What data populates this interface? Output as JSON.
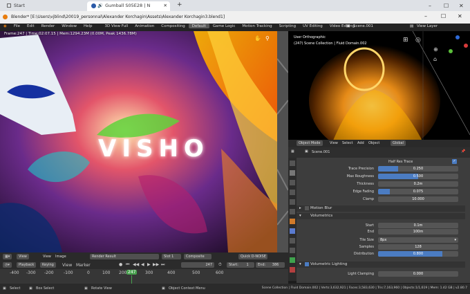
{
  "browser": {
    "tabs": [
      {
        "label": "Start"
      },
      {
        "label": "Gumball S05E28 | N"
      }
    ],
    "new_tab": "+",
    "window_controls": [
      "–",
      "☐",
      "✕"
    ]
  },
  "window": {
    "title": "Blender* [E:\\Users\\vjblind\\20019_personnal\\Alexander Korchagin\\Assets\\Alexander Korchagin3.blend1]"
  },
  "menubar": {
    "menus": [
      "File",
      "Edit",
      "Render",
      "Window",
      "Help"
    ],
    "workspaces": [
      "3D View Full",
      "Animation",
      "Compositing",
      "Default",
      "Game Logic",
      "Motion Tracking",
      "Scripting",
      "UV Editing",
      "Video Editing"
    ],
    "active_workspace": "Default",
    "scene": "Scene.001",
    "view_layer": "View Layer"
  },
  "viewport_left": {
    "status": "Frame:247 | Time:02:07.15 | Mem:1294.23M (0.00M, Peak 1436.78M)",
    "overlay_text": "VISHO",
    "footer": {
      "view": "View",
      "image": "Image",
      "render_result": "Render Result",
      "slot": "Slot 1",
      "composite": "Composite",
      "denoise": "Quick D-NOISE"
    }
  },
  "viewport_right": {
    "label": "User Orthographic",
    "collection": "(247) Scene Collection | Fluid Domain.002",
    "header": {
      "mode": "Object Mode",
      "view": "View",
      "select": "Select",
      "add": "Add",
      "object": "Object",
      "orientation": "Global"
    }
  },
  "properties": {
    "scene": "Scene.001",
    "half_res_trace": "Half Res Trace",
    "rows": [
      {
        "label": "Trace Precision",
        "value": "0.250",
        "fill": 0.25
      },
      {
        "label": "Max Roughness",
        "value": "0.500",
        "fill": 0.5
      },
      {
        "label": "Thickness",
        "value": "0.2m",
        "fill": 0
      },
      {
        "label": "Edge Fading",
        "value": "0.075",
        "fill": 0.15
      },
      {
        "label": "Clamp",
        "value": "10.000",
        "fill": 0
      }
    ],
    "motion_blur": "Motion Blur",
    "volumetrics": "Volumetrics",
    "vol_rows": [
      {
        "label": "Start",
        "value": "0.1m",
        "fill": 0
      },
      {
        "label": "End",
        "value": "100m",
        "fill": 0
      }
    ],
    "tile_size_label": "Tile Size",
    "tile_size": "8px",
    "samples_label": "Samples",
    "samples": "128",
    "distribution_label": "Distribution",
    "distribution": "0.800",
    "distribution_fill": 0.8,
    "vol_lighting": "Volumetric Lighting",
    "light_clamping_label": "Light Clamping",
    "light_clamping": "0.000"
  },
  "timeline": {
    "playback": "Playback",
    "keying": "Keying",
    "view": "View",
    "marker": "Marker",
    "current_frame": "247",
    "start_label": "Start:",
    "start": "1",
    "end_label": "End:",
    "end": "386",
    "ticks": [
      "-400",
      "-300",
      "-200",
      "-100",
      "0",
      "100",
      "200",
      "247",
      "300",
      "400",
      "500",
      "600"
    ]
  },
  "statusbar": {
    "select": "Select",
    "box_select": "Box Select",
    "rotate_view": "Rotate View",
    "context_menu": "Object Context Menu",
    "stats": "Scene Collection | Fluid Domain.002 | Verts:3,632,921 | Faces:3,583,630 | Tris:7,163,960 | Objects:1/1,619 | Mem: 1.42 GB | v2.80.7"
  },
  "colors": {
    "accent": "#4b7cc2",
    "frame_marker": "#47a04d"
  }
}
